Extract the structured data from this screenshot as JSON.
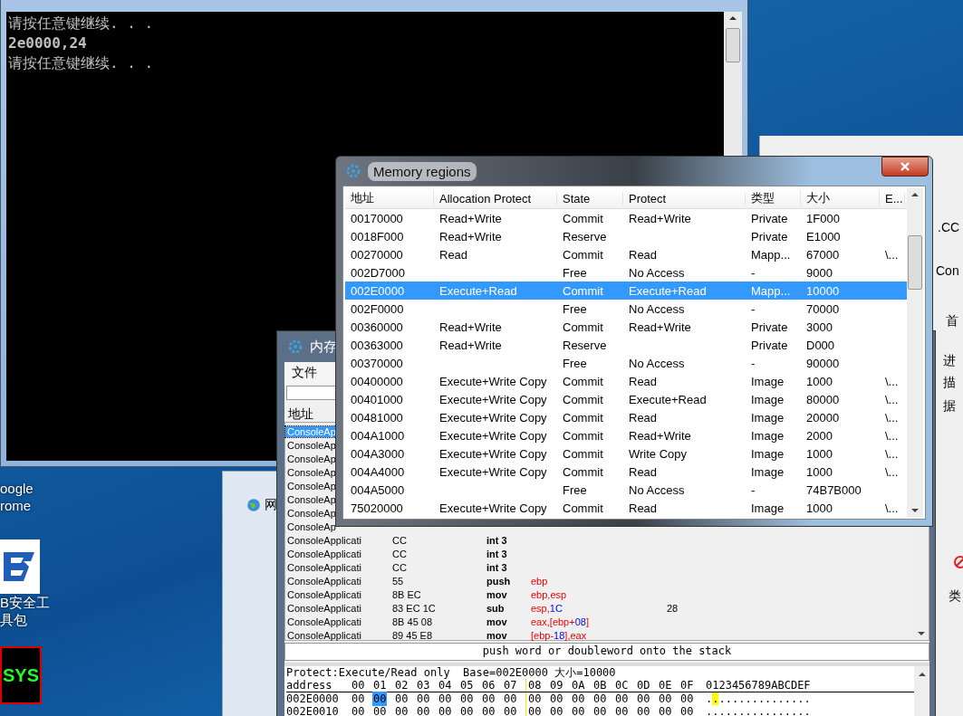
{
  "desktop_icons": [
    {
      "kind": "none",
      "lines": [
        "oogle",
        "rome"
      ]
    },
    {
      "kind": "shield",
      "lines": [
        "B安全工",
        "具包"
      ]
    },
    {
      "kind": "terminal",
      "badge": "SYS"
    }
  ],
  "console": {
    "lines": [
      "请按任意键继续. . .",
      "2e0000,24",
      "请按任意键继续. . ."
    ]
  },
  "background_window": {
    "fragments": [
      ".CC",
      "Con",
      "首",
      "进",
      "描",
      "据",
      "类"
    ]
  },
  "browser_window": {
    "tab_text": "网"
  },
  "memory_viewer": {
    "title": "内存",
    "menu": [
      "文件"
    ],
    "column_header": "地址",
    "rows": [
      {
        "address": "ConsoleAp",
        "selected": true
      },
      {
        "address": "ConsoleAp",
        "selected": false
      },
      {
        "address": "ConsoleAp",
        "selected": false
      },
      {
        "address": "ConsoleAp",
        "selected": false
      },
      {
        "address": "ConsoleAp",
        "selected": false
      },
      {
        "address": "ConsoleAp",
        "selected": false
      },
      {
        "address": "ConsoleAp",
        "selected": false
      },
      {
        "address": "ConsoleAp",
        "selected": false
      },
      {
        "address": "ConsoleApplicati",
        "bytes": "CC",
        "opcode": "int 3",
        "selected": false
      },
      {
        "address": "ConsoleApplicati",
        "bytes": "CC",
        "opcode": "int 3",
        "selected": false
      },
      {
        "address": "ConsoleApplicati",
        "bytes": "CC",
        "opcode": "int 3",
        "selected": false
      },
      {
        "address": "ConsoleApplicati",
        "bytes": "55",
        "opcode": "push",
        "operands": [
          {
            "text": "ebp",
            "kind": "reg"
          }
        ],
        "selected": false
      },
      {
        "address": "ConsoleApplicati",
        "bytes": "8B EC",
        "opcode": "mov",
        "operands": [
          {
            "text": "ebp",
            "kind": "reg"
          },
          {
            "text": ",",
            "kind": "plain"
          },
          {
            "text": "esp",
            "kind": "reg"
          }
        ],
        "selected": false
      },
      {
        "address": "ConsoleApplicati",
        "bytes": "83 EC 1C",
        "opcode": "sub",
        "operands": [
          {
            "text": "esp",
            "kind": "reg"
          },
          {
            "text": ",",
            "kind": "plain"
          },
          {
            "text": "1C",
            "kind": "num"
          }
        ],
        "comment": "28",
        "selected": false
      },
      {
        "address": "ConsoleApplicati",
        "bytes": "8B 45 08",
        "opcode": "mov",
        "operands": [
          {
            "text": "eax",
            "kind": "reg"
          },
          {
            "text": ",[",
            "kind": "plain"
          },
          {
            "text": "ebp",
            "kind": "reg"
          },
          {
            "text": "+",
            "kind": "plain"
          },
          {
            "text": "08",
            "kind": "num"
          },
          {
            "text": "]",
            "kind": "plain"
          }
        ],
        "selected": false
      },
      {
        "address": "ConsoleApplicati",
        "bytes": "89 45 E8",
        "opcode": "mov",
        "operands": [
          {
            "text": "[",
            "kind": "plain"
          },
          {
            "text": "ebp-",
            "kind": "reg"
          },
          {
            "text": "18",
            "kind": "num"
          },
          {
            "text": "],",
            "kind": "plain"
          },
          {
            "text": "eax",
            "kind": "reg"
          }
        ],
        "selected": false
      }
    ],
    "status": "push word or doubleword onto the stack",
    "hex": {
      "info": "Protect:Execute/Read only  Base=002E0000 大小=10000",
      "address_header": "address",
      "columns": [
        "00",
        "01",
        "02",
        "03",
        "04",
        "05",
        "06",
        "07",
        "08",
        "09",
        "0A",
        "0B",
        "0C",
        "0D",
        "0E",
        "0F"
      ],
      "ascii_header": "0123456789ABCDEF",
      "rows": [
        {
          "address": "002E0000",
          "bytes": [
            {
              "text": "00",
              "selected": false
            },
            {
              "text": "00",
              "selected": true
            },
            {
              "text": "00",
              "selected": false
            },
            {
              "text": "00",
              "selected": false
            },
            {
              "text": "00",
              "selected": false
            },
            {
              "text": "00",
              "selected": false
            },
            {
              "text": "00",
              "selected": false
            },
            {
              "text": "00",
              "selected": false
            },
            {
              "text": "00",
              "selected": false
            },
            {
              "text": "00",
              "selected": false
            },
            {
              "text": "00",
              "selected": false
            },
            {
              "text": "00",
              "selected": false
            },
            {
              "text": "00",
              "selected": false
            },
            {
              "text": "00",
              "selected": false
            },
            {
              "text": "00",
              "selected": false
            },
            {
              "text": "00",
              "selected": false
            }
          ],
          "ascii": "................"
        },
        {
          "address": "002E0010",
          "bytes": [
            {
              "text": "00",
              "selected": false
            },
            {
              "text": "00",
              "selected": false
            },
            {
              "text": "00",
              "selected": false
            },
            {
              "text": "00",
              "selected": false
            },
            {
              "text": "00",
              "selected": false
            },
            {
              "text": "00",
              "selected": false
            },
            {
              "text": "00",
              "selected": false
            },
            {
              "text": "00",
              "selected": false
            },
            {
              "text": "00",
              "selected": false
            },
            {
              "text": "00",
              "selected": false
            },
            {
              "text": "00",
              "selected": false
            },
            {
              "text": "00",
              "selected": false
            },
            {
              "text": "00",
              "selected": false
            },
            {
              "text": "00",
              "selected": false
            },
            {
              "text": "00",
              "selected": false
            },
            {
              "text": "00",
              "selected": false
            }
          ],
          "ascii": "................"
        }
      ]
    }
  },
  "memory_regions": {
    "title": "Memory regions",
    "columns": [
      "地址",
      "Allocation Protect",
      "State",
      "Protect",
      "类型",
      "大小",
      "E..."
    ],
    "rows": [
      {
        "cells": [
          "00170000",
          "Read+Write",
          "Commit",
          "Read+Write",
          "Private",
          "1F000",
          ""
        ],
        "selected": false
      },
      {
        "cells": [
          "0018F000",
          "Read+Write",
          "Reserve",
          "",
          "Private",
          "E1000",
          ""
        ],
        "selected": false
      },
      {
        "cells": [
          "00270000",
          "Read",
          "Commit",
          "Read",
          "Mapp...",
          "67000",
          "\\..."
        ],
        "selected": false
      },
      {
        "cells": [
          "002D7000",
          "",
          "Free",
          "No Access",
          "-",
          "9000",
          ""
        ],
        "selected": false
      },
      {
        "cells": [
          "002E0000",
          "Execute+Read",
          "Commit",
          "Execute+Read",
          "Mapp...",
          "10000",
          ""
        ],
        "selected": true
      },
      {
        "cells": [
          "002F0000",
          "",
          "Free",
          "No Access",
          "-",
          "70000",
          ""
        ],
        "selected": false
      },
      {
        "cells": [
          "00360000",
          "Read+Write",
          "Commit",
          "Read+Write",
          "Private",
          "3000",
          ""
        ],
        "selected": false
      },
      {
        "cells": [
          "00363000",
          "Read+Write",
          "Reserve",
          "",
          "Private",
          "D000",
          ""
        ],
        "selected": false
      },
      {
        "cells": [
          "00370000",
          "",
          "Free",
          "No Access",
          "-",
          "90000",
          ""
        ],
        "selected": false
      },
      {
        "cells": [
          "00400000",
          "Execute+Write Copy",
          "Commit",
          "Read",
          "Image",
          "1000",
          "\\..."
        ],
        "selected": false
      },
      {
        "cells": [
          "00401000",
          "Execute+Write Copy",
          "Commit",
          "Execute+Read",
          "Image",
          "80000",
          "\\..."
        ],
        "selected": false
      },
      {
        "cells": [
          "00481000",
          "Execute+Write Copy",
          "Commit",
          "Read",
          "Image",
          "20000",
          "\\..."
        ],
        "selected": false
      },
      {
        "cells": [
          "004A1000",
          "Execute+Write Copy",
          "Commit",
          "Read+Write",
          "Image",
          "2000",
          "\\..."
        ],
        "selected": false
      },
      {
        "cells": [
          "004A3000",
          "Execute+Write Copy",
          "Commit",
          "Write Copy",
          "Image",
          "1000",
          "\\..."
        ],
        "selected": false
      },
      {
        "cells": [
          "004A4000",
          "Execute+Write Copy",
          "Commit",
          "Read",
          "Image",
          "1000",
          "\\..."
        ],
        "selected": false
      },
      {
        "cells": [
          "004A5000",
          "",
          "Free",
          "No Access",
          "-",
          "74B7B000",
          ""
        ],
        "selected": false
      },
      {
        "cells": [
          "75020000",
          "Execute+Write Copy",
          "Commit",
          "Read",
          "Image",
          "1000",
          "\\..."
        ],
        "selected": false
      }
    ]
  }
}
